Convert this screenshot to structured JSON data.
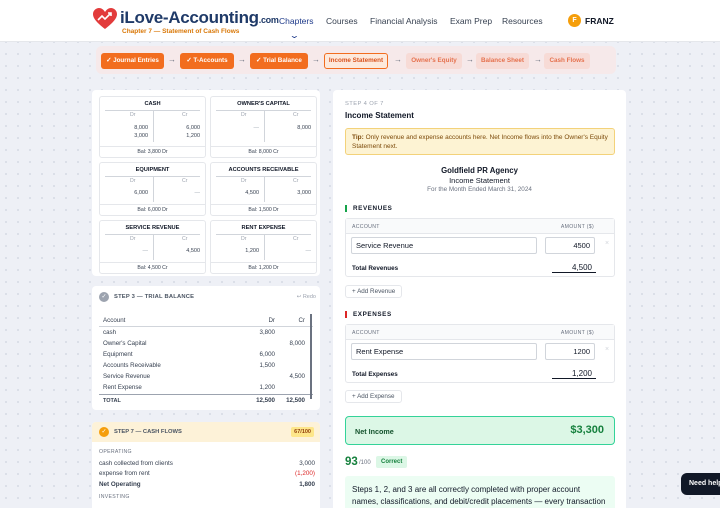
{
  "brand": {
    "name": "iLove-Accounting",
    "domain": ".com",
    "subtitle": "Chapter 7 — Statement of Cash Flows"
  },
  "nav": {
    "items": [
      "Chapters",
      "Courses",
      "Financial Analysis",
      "Exam Prep",
      "Resources"
    ],
    "active": "Chapters",
    "user_initial": "F",
    "user_name": "FRANZ"
  },
  "stepper": {
    "steps": [
      {
        "label": "✓ Journal Entries",
        "state": "done"
      },
      {
        "label": "✓ T-Accounts",
        "state": "done"
      },
      {
        "label": "✓ Trial Balance",
        "state": "done"
      },
      {
        "label": "Income Statement",
        "state": "current"
      },
      {
        "label": "Owner's Equity",
        "state": "future"
      },
      {
        "label": "Balance Sheet",
        "state": "future"
      },
      {
        "label": "Cash Flows",
        "state": "future"
      }
    ]
  },
  "t_accounts": [
    {
      "name": "CASH",
      "dr_label": "Dr",
      "cr_label": "Cr",
      "debits": [
        "8,000",
        "3,000"
      ],
      "credits": [
        "6,000",
        "1,200"
      ],
      "balance": "Bal: 3,800 Dr"
    },
    {
      "name": "OWNER'S CAPITAL",
      "dr_label": "Dr",
      "cr_label": "Cr",
      "debits": [
        "—"
      ],
      "credits": [
        "8,000"
      ],
      "balance": "Bal: 8,000 Cr"
    },
    {
      "name": "EQUIPMENT",
      "dr_label": "Dr",
      "cr_label": "Cr",
      "debits": [
        "6,000"
      ],
      "credits": [
        "—"
      ],
      "balance": "Bal: 6,000 Dr"
    },
    {
      "name": "ACCOUNTS RECEIVABLE",
      "dr_label": "Dr",
      "cr_label": "Cr",
      "debits": [
        "4,500"
      ],
      "credits": [
        "3,000"
      ],
      "balance": "Bal: 1,500 Dr"
    },
    {
      "name": "SERVICE REVENUE",
      "dr_label": "Dr",
      "cr_label": "Cr",
      "debits": [
        "—"
      ],
      "credits": [
        "4,500"
      ],
      "balance": "Bal: 4,500 Cr"
    },
    {
      "name": "RENT EXPENSE",
      "dr_label": "Dr",
      "cr_label": "Cr",
      "debits": [
        "1,200"
      ],
      "credits": [
        "—"
      ],
      "balance": "Bal: 1,200 Dr"
    }
  ],
  "trial_balance": {
    "title": "STEP 3 — TRIAL BALANCE",
    "check": "✓",
    "redo": "↩ Redo",
    "headers": [
      "Account",
      "Dr",
      "Cr"
    ],
    "rows": [
      [
        "cash",
        "3,800",
        ""
      ],
      [
        "Owner's Capital",
        "",
        "8,000"
      ],
      [
        "Equipment",
        "6,000",
        ""
      ],
      [
        "Accounts Receivable",
        "1,500",
        ""
      ],
      [
        "Service Revenue",
        "",
        "4,500"
      ],
      [
        "Rent Expense",
        "1,200",
        ""
      ]
    ],
    "total": [
      "TOTAL",
      "12,500",
      "12,500"
    ]
  },
  "cash_flows": {
    "title": "STEP 7 — CASH FLOWS",
    "check": "✓",
    "score": "67/100",
    "operating_label": "OPERATING",
    "lines": [
      {
        "label": "cash collected from clients",
        "amount": "3,000"
      },
      {
        "label": "expense from rent",
        "amount": "(1,200)"
      }
    ],
    "net_label": "Net Operating",
    "net_amount": "1,800",
    "investing_label": "INVESTING"
  },
  "income_statement": {
    "step_label": "STEP 4 OF 7",
    "title": "Income Statement",
    "tip_bold": "Tip:",
    "tip_text": " Only revenue and expense accounts here. Net Income flows into the Owner's Equity Statement next.",
    "company": "Goldfield PR Agency",
    "statement": "Income Statement",
    "period": "For the Month Ended March 31, 2024",
    "revenues_label": "REVENUES",
    "expenses_label": "EXPENSES",
    "col_account": "ACCOUNT",
    "col_amount": "AMOUNT ($)",
    "revenue_account": "Service Revenue",
    "revenue_amount": "4500",
    "total_revenues_label": "Total Revenues",
    "total_revenues": "4,500",
    "add_revenue": "+ Add Revenue",
    "expense_account": "Rent Expense",
    "expense_amount": "1200",
    "total_expenses_label": "Total Expenses",
    "total_expenses": "1,200",
    "add_expense": "+ Add Expense",
    "remove_glyph": "×",
    "net_income_label": "Net Income",
    "net_income": "$3,300",
    "score": "93",
    "score_of": "/100",
    "score_status": "Correct",
    "feedback": "Steps 1, 2, and 3 are all correctly completed with proper account names, classifications, and debit/credit placements — every transaction is"
  },
  "help": "Need help?",
  "colors": {
    "accent_orange": "#f26d1f",
    "navy": "#1f3a68",
    "success_green": "#15803d",
    "danger_red": "#dc2626"
  }
}
